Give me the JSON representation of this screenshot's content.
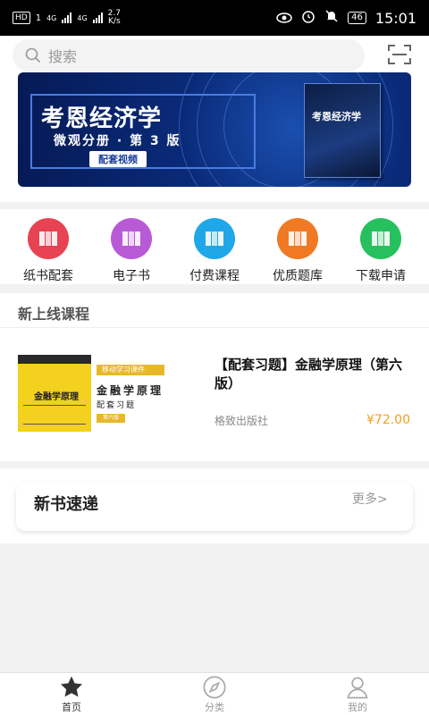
{
  "status_bar": {
    "hd": "HD",
    "sim": "1",
    "net1": "4G",
    "net2": "4G",
    "speed_value": "2.7",
    "speed_unit": "K/s",
    "battery": "46",
    "time": "15:01"
  },
  "search": {
    "placeholder": "搜索"
  },
  "banner": {
    "title": "考恩经济学",
    "subtitle": "微观分册 · 第 3 版",
    "tag": "配套视频",
    "book_title": "考恩经济学"
  },
  "categories": [
    {
      "label": "纸书配套",
      "color": "#e84352"
    },
    {
      "label": "电子书",
      "color": "#b85ad6"
    },
    {
      "label": "付费课程",
      "color": "#1fa7e8"
    },
    {
      "label": "优质题库",
      "color": "#f07a23"
    },
    {
      "label": "下载申请",
      "color": "#27c05e"
    }
  ],
  "new_courses": {
    "section_title": "新上线课程",
    "items": [
      {
        "cover_title": "金融学原理",
        "cover_tag": "移动学习课件",
        "cover_main": "金融学原理",
        "cover_sub": "配套习题",
        "cover_small_tag": "第六版",
        "name": "【配套习题】金融学原理（第六版）",
        "publisher": "格致出版社",
        "price": "¥72.00"
      }
    ]
  },
  "new_books": {
    "title": "新书速递",
    "more": "更多>"
  },
  "bottom_nav": [
    {
      "label": "首页",
      "icon": "star-icon",
      "active": true
    },
    {
      "label": "分类",
      "icon": "compass-icon",
      "active": false
    },
    {
      "label": "我的",
      "icon": "user-icon",
      "active": false
    }
  ]
}
